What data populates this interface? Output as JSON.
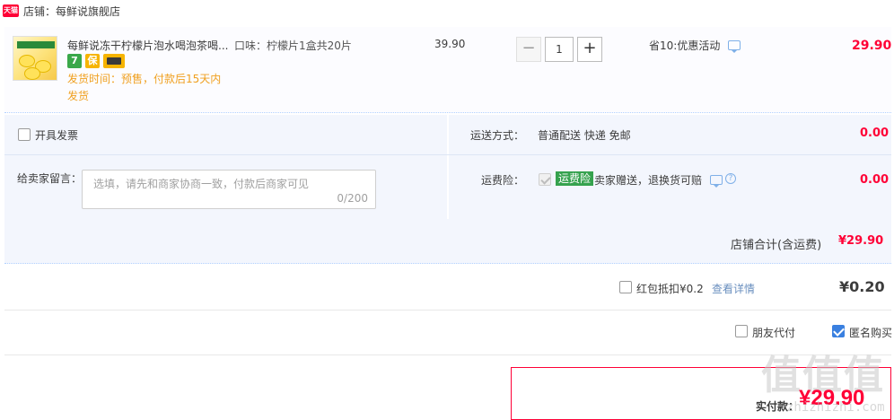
{
  "shop": {
    "badge": "天猫",
    "label": "店铺：每鲜说旗舰店"
  },
  "item": {
    "title": "每鲜说冻干柠檬片泡水喝泡茶喝...",
    "spec": "口味：柠檬片1盒共20片",
    "unit_price": "39.90",
    "quantity": "1",
    "minus": "−",
    "plus": "+",
    "badges": [
      {
        "icon": "seven-day-return-icon",
        "text": "7",
        "color": "#3aa84a"
      },
      {
        "icon": "guarantee-icon",
        "text": "保",
        "color": "#f6b400"
      },
      {
        "icon": "card-payment-icon",
        "text": "",
        "color": "#f6b400"
      }
    ],
    "ship_time": "发货时间：预售，付款后15天内",
    "ship_note": "发货",
    "promo": "省10:优惠活动",
    "subtotal": "29.90"
  },
  "options": {
    "invoice_label": "开具发票",
    "shipping_label": "运送方式：",
    "shipping_value": "普通配送 快递 免邮",
    "shipping_fee": "0.00",
    "message_label": "给卖家留言：",
    "message_placeholder": "选填，请先和商家协商一致，付款后商家可见",
    "message_count": "0/200",
    "insurance_label": "运费险：",
    "insurance_badge": "运费险",
    "insurance_text": "卖家赠送，退换货可赔",
    "insurance_fee": "0.00"
  },
  "shop_total": {
    "label": "店铺合计(含运费)",
    "value": "¥29.90"
  },
  "red_packet": {
    "label": "红包抵扣¥0.2",
    "link": "查看详情",
    "value": "¥0.20"
  },
  "pay_options": {
    "friend_pay": "朋友代付",
    "anonymous": "匿名购买"
  },
  "final": {
    "label": "实付款：",
    "amount": "¥29.90"
  },
  "watermark": {
    "main": "值值值",
    "sub": "zhizhizhi.com"
  },
  "colors": {
    "accent": "#ff0036",
    "link": "#6a8fbf",
    "panel": "#f3f6fd",
    "checked": "#3a80e0"
  }
}
